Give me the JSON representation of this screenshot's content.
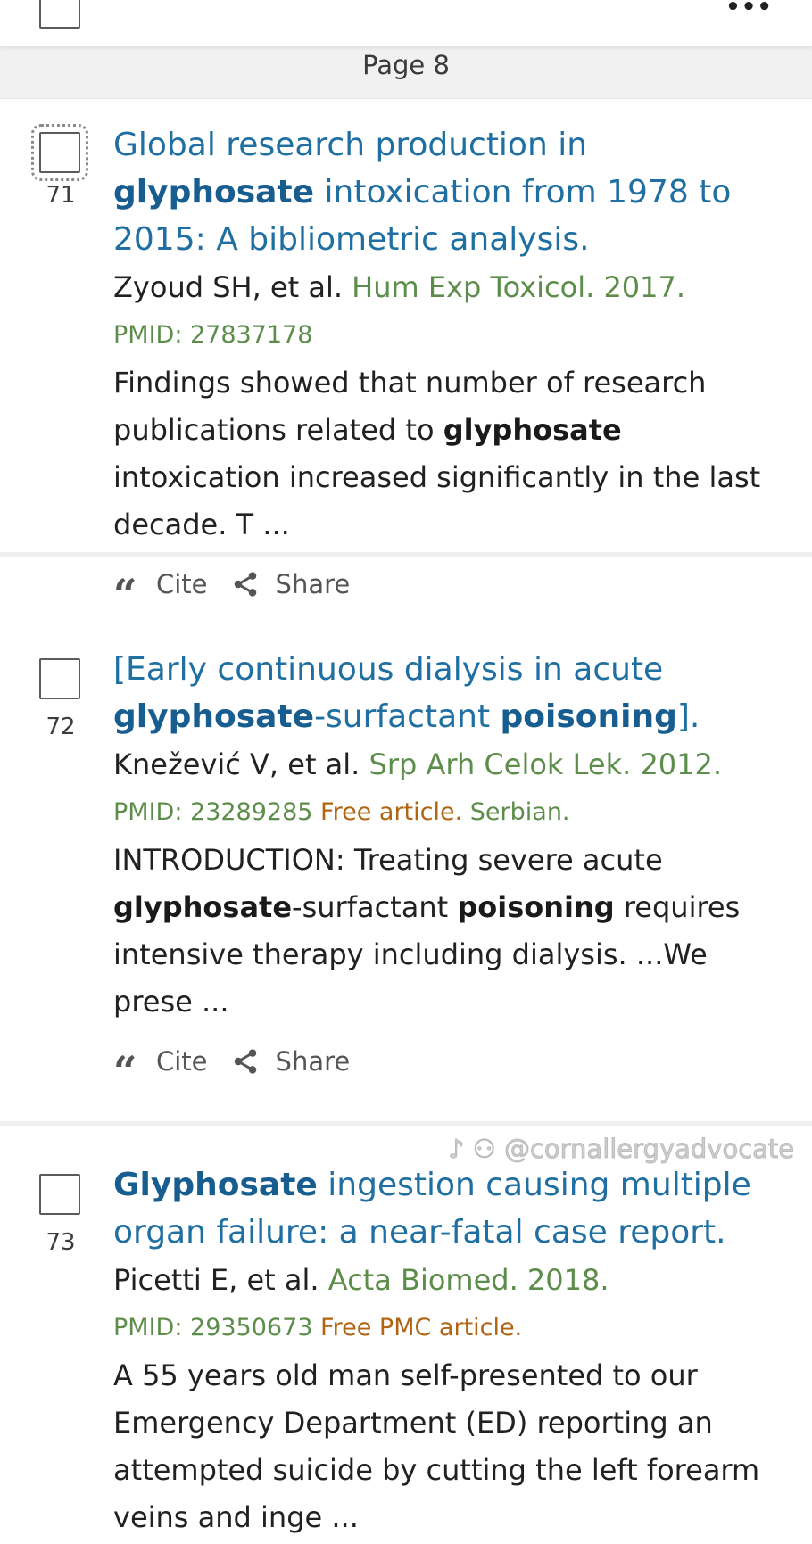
{
  "toolbar": {
    "more_label": "•••"
  },
  "page_band": {
    "label": "Page 8"
  },
  "actions": {
    "cite": "Cite",
    "share": "Share"
  },
  "results": [
    {
      "number": "71",
      "title": [
        {
          "text": "Global research production in ",
          "bold": false
        },
        {
          "text": "glyphosate",
          "bold": true
        },
        {
          "text": " intoxication from 1978 to 2015: A bibliometric analysis.",
          "bold": false
        }
      ],
      "authors": "Zyoud SH, et al.",
      "journal": "Hum Exp Toxicol. 2017.",
      "pmid": "PMID: 27837178",
      "free": "",
      "language": "",
      "snippet": [
        {
          "text": "Findings showed that number of research publications related to ",
          "bold": false
        },
        {
          "text": "glyphosate",
          "bold": true
        },
        {
          "text": " intoxication increased significantly in the last decade. T ...",
          "bold": false
        }
      ]
    },
    {
      "number": "72",
      "title": [
        {
          "text": "[Early continuous dialysis in acute ",
          "bold": false
        },
        {
          "text": "glyphosate",
          "bold": true
        },
        {
          "text": "-surfactant ",
          "bold": false
        },
        {
          "text": "poisoning",
          "bold": true
        },
        {
          "text": "].",
          "bold": false
        }
      ],
      "authors": "Knežević V, et al.",
      "journal": "Srp Arh Celok Lek. 2012.",
      "pmid": "PMID: 23289285",
      "free": "Free article.",
      "language": "Serbian.",
      "snippet": [
        {
          "text": "INTRODUCTION: Treating severe acute ",
          "bold": false
        },
        {
          "text": "glyphosate",
          "bold": true
        },
        {
          "text": "-surfactant ",
          "bold": false
        },
        {
          "text": "poisoning",
          "bold": true
        },
        {
          "text": " requires intensive therapy including dialysis. ...We prese ...",
          "bold": false
        }
      ]
    },
    {
      "number": "73",
      "title": [
        {
          "text": "Glyphosate",
          "bold": true
        },
        {
          "text": " ingestion causing multiple organ failure: a near-fatal case report.",
          "bold": false
        }
      ],
      "authors": "Picetti E, et al.",
      "journal": "Acta Biomed. 2018.",
      "pmid": "PMID: 29350673",
      "free": "Free PMC article.",
      "language": "",
      "snippet": [
        {
          "text": "A 55 years old man self-presented to our Emergency Department (ED) reporting an attempted suicide by cutting the left forearm veins and inge ...",
          "bold": false
        }
      ]
    }
  ],
  "watermark": "♪ ⚇ @cornallergyadvocate",
  "colors": {
    "title_link": "#1f6fa2",
    "journal_green": "#5d8d4a",
    "free_orange": "#b16412"
  }
}
